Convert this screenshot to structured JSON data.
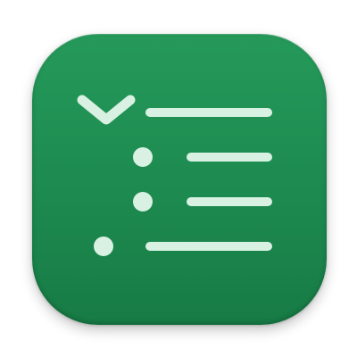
{
  "app_icon": {
    "name": "outline-list-app-icon",
    "background_color": "#1e8c50",
    "glyph_color": "#d8f0e2",
    "rows": [
      {
        "marker": "chevron-down-icon",
        "indent_level": 0
      },
      {
        "marker": "bullet-icon",
        "indent_level": 1
      },
      {
        "marker": "bullet-icon",
        "indent_level": 1
      },
      {
        "marker": "bullet-icon",
        "indent_level": 0
      }
    ]
  }
}
